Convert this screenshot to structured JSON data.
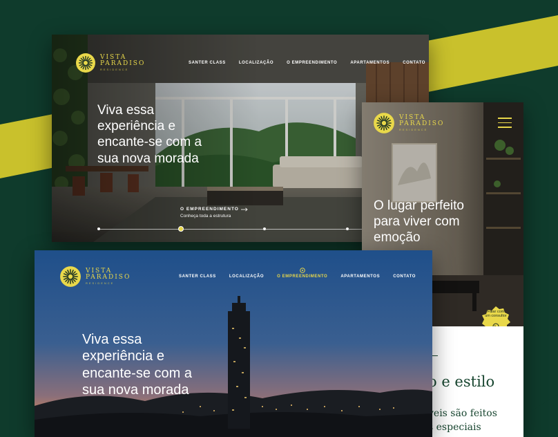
{
  "brand": {
    "line1": "VISTA",
    "line2": "PARADISO",
    "line3": "RESIDENCE"
  },
  "colors": {
    "background_green": "#0f3b2c",
    "accent_yellow": "#e9d84a",
    "band_yellow": "#c9c12c",
    "text_white": "#ffffff",
    "deep_green": "#17452f"
  },
  "icons": {
    "logo": "sun-flower-icon",
    "arrow": "arrow-right-icon",
    "menu": "hamburger-menu-icon",
    "whatsapp": "whatsapp-icon",
    "active_nav": "sun-dot-icon"
  },
  "screen_a": {
    "nav": [
      "SANTER CLASS",
      "LOCALIZAÇÃO",
      "O EMPREENDIMENTO",
      "APARTAMENTOS",
      "CONTATO"
    ],
    "headline": [
      "Viva essa",
      "experiência e",
      "encante-se com a",
      "sua nova morada"
    ],
    "cta_title": "O EMPREENDIMENTO",
    "cta_subtitle": "Conheça toda a estrutura",
    "slider": {
      "count": 4,
      "active_index": 1
    }
  },
  "screen_b": {
    "headline": [
      "O lugar perfeito",
      "para viver com",
      "emoção"
    ],
    "whatsapp_label": [
      "Falar com",
      "um consultor"
    ],
    "section_heading": "o e estilo",
    "section_body": [
      "veis são feitos",
      "s especiais"
    ]
  },
  "screen_c": {
    "nav": [
      "SANTER CLASS",
      "LOCALIZAÇÃO",
      "O EMPREENDIMENTO",
      "APARTAMENTOS",
      "CONTATO"
    ],
    "active_nav_index": 2,
    "headline": [
      "Viva essa",
      "experiência e",
      "encante-se com a",
      "sua nova morada"
    ]
  }
}
